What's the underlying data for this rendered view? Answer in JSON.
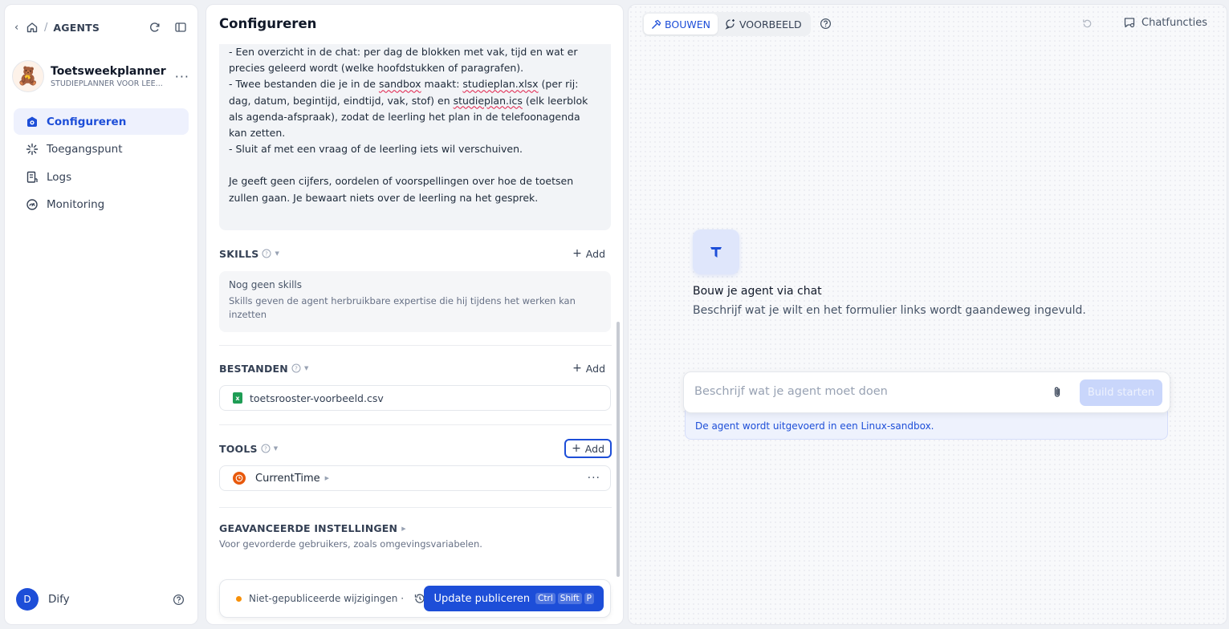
{
  "sidebar": {
    "breadcrumb": "AGENTS",
    "agent": {
      "name": "Toetsweekplanner",
      "subtitle": "STUDIEPLANNER VOOR LEE...",
      "avatar_emoji": "🧸"
    },
    "nav": [
      {
        "label": "Configureren",
        "icon": "robot-icon",
        "active": true
      },
      {
        "label": "Toegangspunt",
        "icon": "access-point-icon"
      },
      {
        "label": "Logs",
        "icon": "logs-icon"
      },
      {
        "label": "Monitoring",
        "icon": "monitoring-icon"
      }
    ],
    "user": {
      "initial": "D",
      "name": "Dify"
    }
  },
  "config": {
    "title": "Configureren",
    "prompt_lines": [
      "- Een overzicht in de chat: per dag de blokken met vak, tijd en wat er precies geleerd wordt (welke hoofdstukken of paragrafen).",
      "- Twee bestanden die je in de sandbox maakt: studieplan.xlsx (per rij: dag, datum, begintijd, eindtijd, vak, stof) en studieplan.ics (elk leerblok als agenda-afspraak), zodat de leerling het plan in de telefoonagenda kan zetten.",
      "- Sluit af met een vraag of de leerling iets wil verschuiven.",
      "Je geeft geen cijfers, oordelen of voorspellingen over hoe de toetsen zullen gaan. Je bewaart niets over de leerling na het gesprek."
    ],
    "skills": {
      "title": "SKILLS",
      "add": "Add",
      "empty_title": "Nog geen skills",
      "empty_desc": "Skills geven de agent herbruikbare expertise die hij tijdens het werken kan inzetten"
    },
    "files": {
      "title": "BESTANDEN",
      "add": "Add",
      "items": [
        "toetsrooster-voorbeeld.csv"
      ]
    },
    "tools": {
      "title": "TOOLS",
      "add": "Add",
      "items": [
        "CurrentTime"
      ]
    },
    "advanced": {
      "title": "GEAVANCEERDE INSTELLINGEN",
      "desc": "Voor gevorderde gebruikers, zoals omgevingsvariabelen."
    },
    "publish": {
      "status": "Niet-gepubliceerde wijzigingen ·",
      "button": "Update publiceren",
      "shortcut": [
        "Ctrl",
        "Shift",
        "P"
      ]
    }
  },
  "preview": {
    "tabs": [
      {
        "label": "BOUWEN",
        "active": true
      },
      {
        "label": "VOORBEELD",
        "active": false
      }
    ],
    "chat_functions": "Chatfuncties",
    "hero_title": "Bouw je agent via chat",
    "hero_subtitle": "Beschrijf wat je wilt en het formulier links wordt gaandeweg ingevuld.",
    "input_placeholder": "Beschrijf wat je agent moet doen",
    "build_button": "Build starten",
    "sandbox_note": "De agent wordt uitgevoerd in een Linux-sandbox."
  },
  "colors": {
    "accent": "#1d4ed8",
    "unpublished_dot": "#f79009",
    "tool_icon": "#e8590c",
    "file_icon": "#1f9d55"
  }
}
